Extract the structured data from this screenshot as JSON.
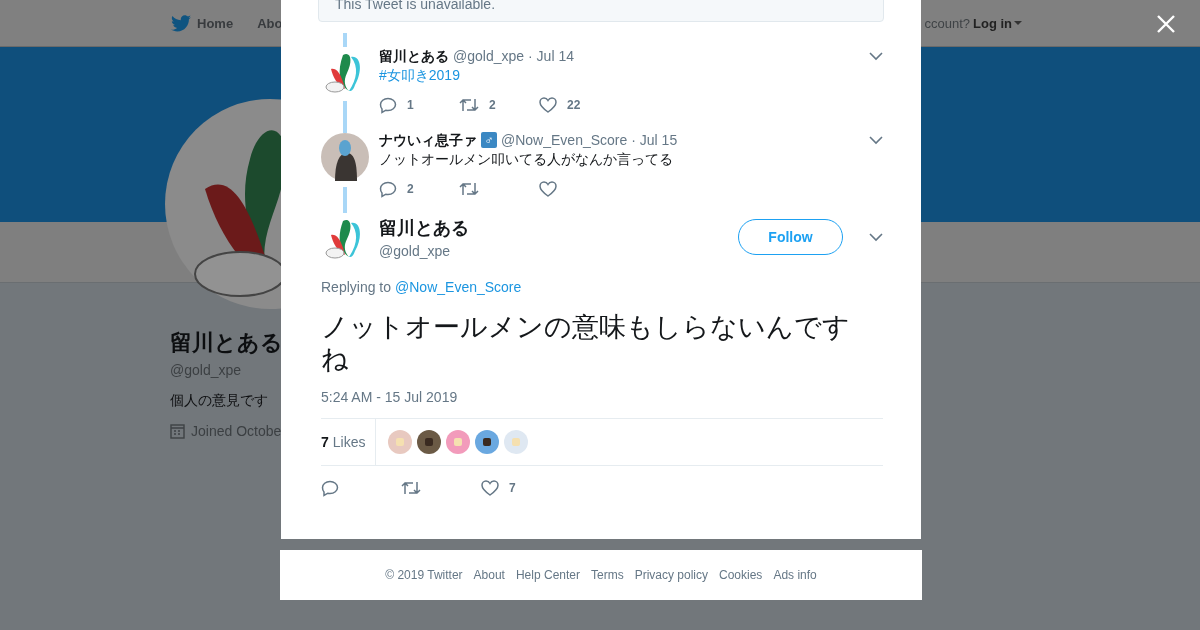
{
  "background_page": {
    "nav": {
      "home": "Home",
      "about": "Abo",
      "account_prompt": "ccount?",
      "login": "Log in"
    },
    "profile": {
      "name": "留川とある",
      "handle": "@gold_xpe",
      "bio": "個人の意見です",
      "joined": "Joined Octobe"
    }
  },
  "modal": {
    "unavailable_notice": "This Tweet is unavailable.",
    "thread": [
      {
        "name": "留川とある",
        "handle": "@gold_xpe",
        "date": "· Jul 14",
        "hashtag": "#女叩き2019",
        "actions": [
          {
            "kind": "reply",
            "count": "1"
          },
          {
            "kind": "retweet",
            "count": "2"
          },
          {
            "kind": "like",
            "count": "22"
          }
        ]
      },
      {
        "name": "ナウいィ息子ァ",
        "badge": "♂",
        "handle": "@Now_Even_Score",
        "date": "· Jul 15",
        "text": "ノットオールメン叩いてる人がなんか言ってる",
        "actions": [
          {
            "kind": "reply",
            "count": "2"
          },
          {
            "kind": "retweet"
          },
          {
            "kind": "like"
          }
        ]
      }
    ],
    "main_tweet": {
      "name": "留川とある",
      "handle": "@gold_xpe",
      "follow_button": "Follow",
      "replying_label": "Replying to",
      "replying_to": "@Now_Even_Score",
      "text": "ノットオールメンの意味もしらないんですね",
      "timestamp": "5:24 AM - 15 Jul 2019",
      "likes_count": "7",
      "likes_label": "Likes",
      "actions": [
        {
          "kind": "reply"
        },
        {
          "kind": "retweet"
        },
        {
          "kind": "like",
          "count": "7"
        }
      ]
    }
  },
  "footer": [
    "© 2019 Twitter",
    "About",
    "Help Center",
    "Terms",
    "Privacy policy",
    "Cookies",
    "Ads info"
  ]
}
